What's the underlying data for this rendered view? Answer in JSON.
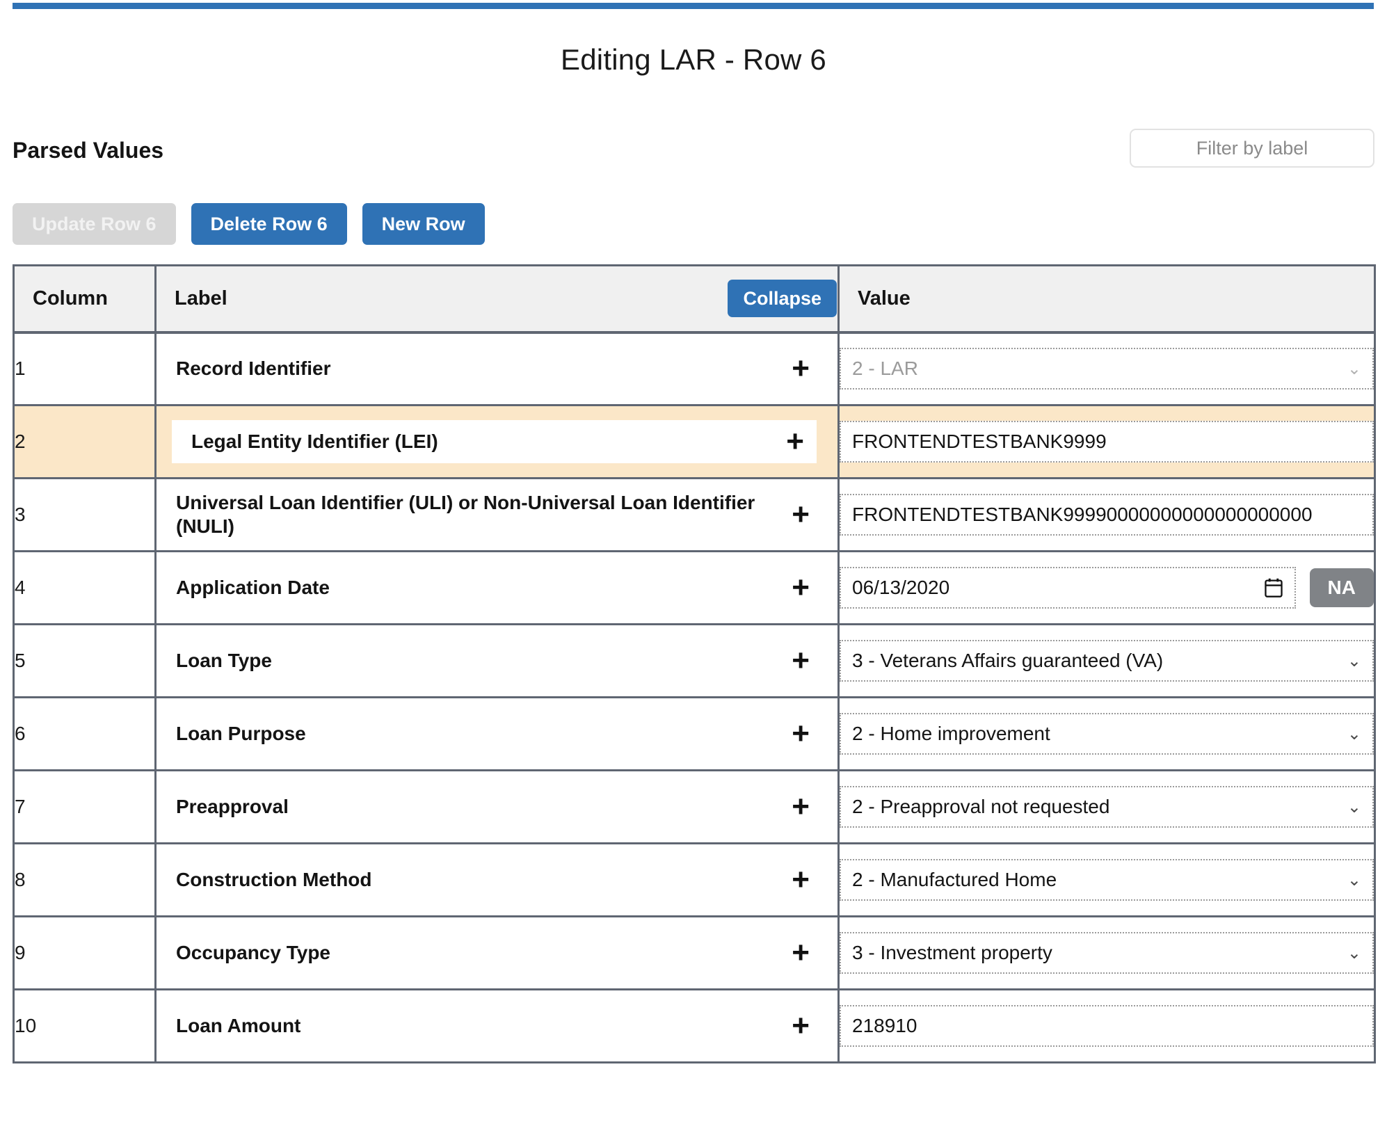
{
  "theme": {
    "accent": "#2f72b5",
    "highlight_row_bg": "#fbe7c8",
    "na_button_bg": "#808387",
    "border": "#5f6672"
  },
  "page_title": "Editing LAR - Row 6",
  "section": {
    "heading": "Parsed Values"
  },
  "filter": {
    "placeholder": "Filter by label",
    "value": ""
  },
  "actions": {
    "update_label": "Update Row 6",
    "delete_label": "Delete Row 6",
    "new_label": "New Row"
  },
  "table": {
    "headers": {
      "column": "Column",
      "label": "Label",
      "value": "Value",
      "collapse_label": "Collapse"
    },
    "expand_icon": "+",
    "rows": [
      {
        "column": "1",
        "label": "Record Identifier",
        "value": "2 - LAR",
        "control": "select",
        "disabled": true,
        "highlighted": false
      },
      {
        "column": "2",
        "label": "Legal Entity Identifier (LEI)",
        "value": "FRONTENDTESTBANK9999",
        "control": "text",
        "disabled": false,
        "highlighted": true
      },
      {
        "column": "3",
        "label": "Universal Loan Identifier (ULI) or Non-Universal Loan Identifier (NULI)",
        "value": "FRONTENDTESTBANK99990000000000000000000",
        "control": "text",
        "disabled": false,
        "highlighted": false
      },
      {
        "column": "4",
        "label": "Application Date",
        "value": "06/13/2020",
        "control": "date",
        "na_label": "NA",
        "disabled": false,
        "highlighted": false
      },
      {
        "column": "5",
        "label": "Loan Type",
        "value": "3 - Veterans Affairs guaranteed (VA)",
        "control": "select",
        "disabled": false,
        "highlighted": false
      },
      {
        "column": "6",
        "label": "Loan Purpose",
        "value": "2 - Home improvement",
        "control": "select",
        "disabled": false,
        "highlighted": false
      },
      {
        "column": "7",
        "label": "Preapproval",
        "value": "2 - Preapproval not requested",
        "control": "select",
        "disabled": false,
        "highlighted": false
      },
      {
        "column": "8",
        "label": "Construction Method",
        "value": "2 - Manufactured Home",
        "control": "select",
        "disabled": false,
        "highlighted": false
      },
      {
        "column": "9",
        "label": "Occupancy Type",
        "value": "3 - Investment property",
        "control": "select",
        "disabled": false,
        "highlighted": false
      },
      {
        "column": "10",
        "label": "Loan Amount",
        "value": "218910",
        "control": "text",
        "disabled": false,
        "highlighted": false
      }
    ]
  }
}
